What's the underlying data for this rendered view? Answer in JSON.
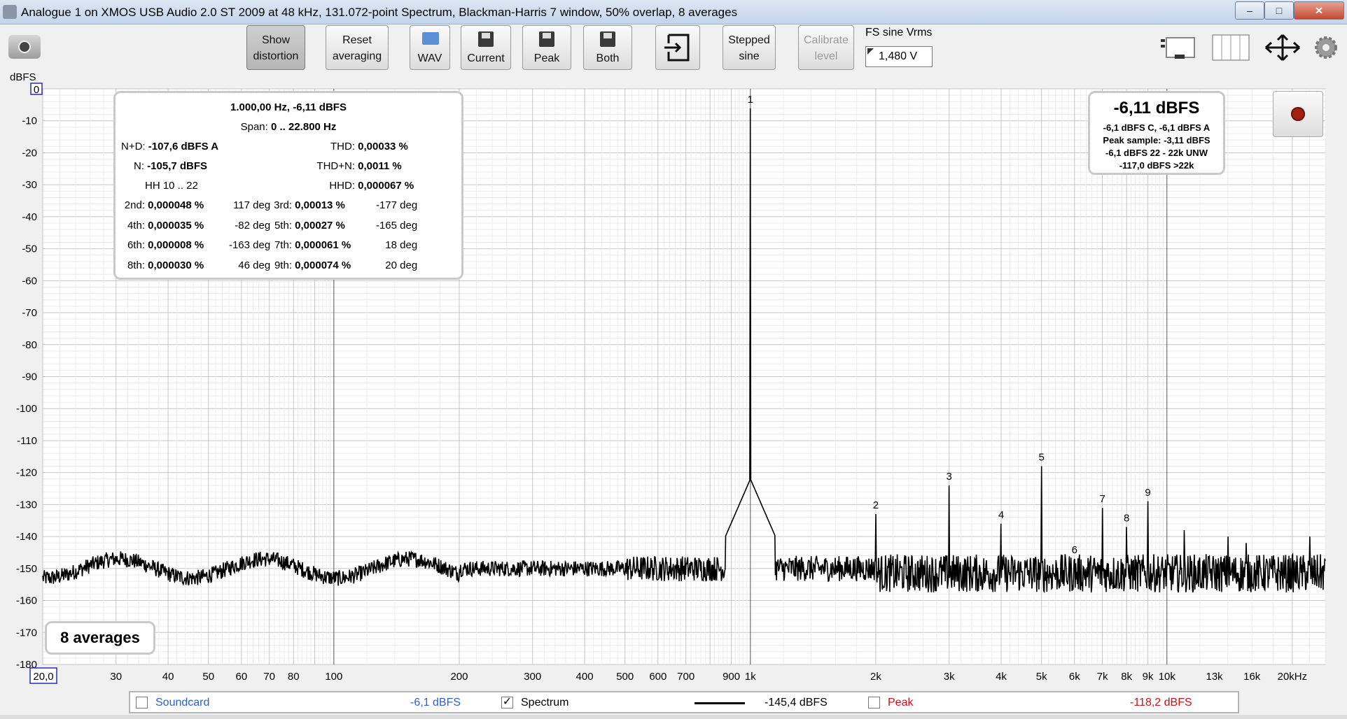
{
  "window": {
    "title": "Analogue 1 on XMOS USB Audio 2.0 ST 2009 at 48 kHz, 131.072-point Spectrum, Blackman-Harris 7 window, 50% overlap, 8 averages",
    "minimize": "–",
    "maximize": "□",
    "close": "✕"
  },
  "toolbar": {
    "show_distortion": [
      "Show",
      "distortion"
    ],
    "reset_averaging": [
      "Reset",
      "averaging"
    ],
    "wav": "WAV",
    "current": "Current",
    "peak": "Peak",
    "both": "Both",
    "stepped_sine": [
      "Stepped",
      "sine"
    ],
    "calibrate_level": [
      "Calibrate",
      "level"
    ],
    "fs_label": "FS sine Vrms",
    "fs_value": "1,480 V"
  },
  "distortion_panel": {
    "header": "1.000,00 Hz, -6,11 dBFS",
    "span_label": "Span:",
    "span": "0 .. 22.800 Hz",
    "nd_label": "N+D:",
    "nd": "-107,6 dBFS A",
    "thd_label": "THD:",
    "thd": "0,00033 %",
    "n_label": "N:",
    "n": "-105,7 dBFS",
    "thdn_label": "THD+N:",
    "thdn": "0,0011 %",
    "hh": "HH 10 .. 22",
    "hhd_label": "HHD:",
    "hhd": "0,000067 %",
    "harmonics": [
      {
        "label": "2nd:",
        "pct": "0,000048 %",
        "deg": "117 deg"
      },
      {
        "label": "3rd:",
        "pct": "0,00013 %",
        "deg": "-177 deg"
      },
      {
        "label": "4th:",
        "pct": "0,000035 %",
        "deg": "-82 deg"
      },
      {
        "label": "5th:",
        "pct": "0,00027 %",
        "deg": "-165 deg"
      },
      {
        "label": "6th:",
        "pct": "0,000008 %",
        "deg": "-163 deg"
      },
      {
        "label": "7th:",
        "pct": "0,000061 %",
        "deg": "18 deg"
      },
      {
        "label": "8th:",
        "pct": "0,000030 %",
        "deg": "46 deg"
      },
      {
        "label": "9th:",
        "pct": "0,000074 %",
        "deg": "20 deg"
      }
    ]
  },
  "level_panel": {
    "main": "-6,11 dBFS",
    "lines": [
      "-6,1 dBFS C, -6,1 dBFS A",
      "Peak sample: -3,11 dBFS",
      "-6,1 dBFS 22 - 22k UNW",
      "-117,0 dBFS >22k"
    ]
  },
  "averages_badge": "8 averages",
  "legend": {
    "soundcard": "Soundcard",
    "soundcard_value": "-6,1 dBFS",
    "spectrum": "Spectrum",
    "spectrum_value": "-145,4 dBFS",
    "spectrum_check": "✓",
    "peak": "Peak",
    "peak_value": "-118,2 dBFS"
  },
  "colors": {
    "soundcard": "#2b5fd9",
    "peak": "#cc1111",
    "harmonic_label": "#2a2ab8",
    "trace": "#000000"
  },
  "icons": [
    "camera-icon",
    "folder-icon",
    "disk-icon",
    "export-icon",
    "layout-icon",
    "columns-icon",
    "pan-icon",
    "gear-icon"
  ],
  "chart_data": {
    "type": "line",
    "ylabel": "dBFS",
    "xscale": "log",
    "xlim": [
      20,
      24000
    ],
    "ylim": [
      -180,
      0
    ],
    "yticks": [
      "-10",
      "-20",
      "-30",
      "-40",
      "-50",
      "-60",
      "-70",
      "-80",
      "-90",
      "-100",
      "-110",
      "-120",
      "-130",
      "-140",
      "-150",
      "-160",
      "-170",
      "-180"
    ],
    "ytop_label": "0",
    "xticks": [
      {
        "v": 30,
        "t": "30"
      },
      {
        "v": 40,
        "t": "40"
      },
      {
        "v": 50,
        "t": "50"
      },
      {
        "v": 60,
        "t": "60"
      },
      {
        "v": 70,
        "t": "70"
      },
      {
        "v": 80,
        "t": "80"
      },
      {
        "v": 100,
        "t": "100"
      },
      {
        "v": 200,
        "t": "200"
      },
      {
        "v": 300,
        "t": "300"
      },
      {
        "v": 400,
        "t": "400"
      },
      {
        "v": 500,
        "t": "500"
      },
      {
        "v": 600,
        "t": "600"
      },
      {
        "v": 700,
        "t": "700"
      },
      {
        "v": 900,
        "t": "900"
      },
      {
        "v": 1000,
        "t": "1k"
      },
      {
        "v": 2000,
        "t": "2k"
      },
      {
        "v": 3000,
        "t": "3k"
      },
      {
        "v": 4000,
        "t": "4k"
      },
      {
        "v": 5000,
        "t": "5k"
      },
      {
        "v": 6000,
        "t": "6k"
      },
      {
        "v": 7000,
        "t": "7k"
      },
      {
        "v": 8000,
        "t": "8k"
      },
      {
        "v": 9000,
        "t": "9k"
      },
      {
        "v": 10000,
        "t": "10k"
      },
      {
        "v": 13000,
        "t": "13k"
      },
      {
        "v": 16000,
        "t": "16k"
      },
      {
        "v": 20000,
        "t": "20kHz"
      }
    ],
    "xstart_label": "20,0",
    "noise_floor_db": -150,
    "fundamental": {
      "freq": 1000,
      "db": -6.1
    },
    "harmonics": [
      {
        "n": "1",
        "freq": 1000,
        "db": -6.1
      },
      {
        "n": "2",
        "freq": 2000,
        "db": -133
      },
      {
        "n": "3",
        "freq": 3000,
        "db": -124
      },
      {
        "n": "4",
        "freq": 4000,
        "db": -136
      },
      {
        "n": "5",
        "freq": 5000,
        "db": -118
      },
      {
        "n": "6",
        "freq": 6000,
        "db": -147
      },
      {
        "n": "7",
        "freq": 7000,
        "db": -131
      },
      {
        "n": "8",
        "freq": 8000,
        "db": -137
      },
      {
        "n": "9",
        "freq": 9000,
        "db": -129
      }
    ],
    "spurs": [
      {
        "freq": 11000,
        "db": -138
      },
      {
        "freq": 14000,
        "db": -140
      },
      {
        "freq": 15500,
        "db": -142
      },
      {
        "freq": 22000,
        "db": -140
      }
    ]
  }
}
